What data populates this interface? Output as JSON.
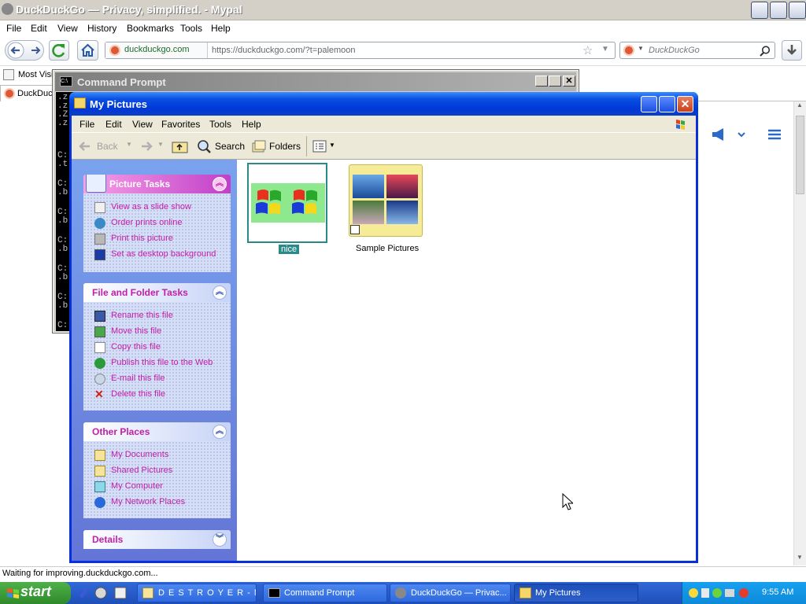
{
  "browser": {
    "window_title": "DuckDuckGo — Privacy, simplified. - Mypal",
    "menu": [
      "File",
      "Edit",
      "View",
      "History",
      "Bookmarks",
      "Tools",
      "Help"
    ],
    "identity": "duckduckgo.com",
    "url": "https://duckduckgo.com/?t=palemoon",
    "search_placeholder": "DuckDuckGo",
    "bookmark_item": "Most Visit",
    "tab_label": "DuckDuckGo",
    "status": "Waiting for improving.duckduckgo.com..."
  },
  "cmd": {
    "title": "Command Prompt",
    "lines": [
      ".z",
      ".z",
      ".Z",
      ".z",
      "C:",
      ".t",
      "C:",
      ".b",
      "C:",
      ".b",
      "C:",
      ".b",
      "C:",
      ".b",
      "C:",
      ".b",
      "C:"
    ]
  },
  "explorer": {
    "title": "My Pictures",
    "menu": [
      "File",
      "Edit",
      "View",
      "Favorites",
      "Tools",
      "Help"
    ],
    "toolbar": {
      "back": "Back",
      "search": "Search",
      "folders": "Folders"
    },
    "panels": {
      "picture_tasks": {
        "title": "Picture Tasks",
        "items": [
          "View as a slide show",
          "Order prints online",
          "Print this picture",
          "Set as desktop background"
        ]
      },
      "file_folder_tasks": {
        "title": "File and Folder Tasks",
        "items": [
          "Rename this file",
          "Move this file",
          "Copy this file",
          "Publish this file to the Web",
          "E-mail this file",
          "Delete this file"
        ]
      },
      "other_places": {
        "title": "Other Places",
        "items": [
          "My Documents",
          "Shared Pictures",
          "My Computer",
          "My Network Places"
        ]
      },
      "details": {
        "title": "Details"
      }
    },
    "files": [
      {
        "name": "nice",
        "selected": true
      },
      {
        "name": "Sample Pictures",
        "selected": false
      }
    ]
  },
  "taskbar": {
    "start": "start",
    "buttons": [
      "D E S T R O Y E R - N...",
      "Command Prompt",
      "DuckDuckGo — Privac...",
      "My Pictures"
    ],
    "active_button": "My Pictures",
    "clock": "9:55 AM"
  },
  "colors": {
    "xp_blue": "#0831d9",
    "task_pink": "#c020a8",
    "taskbar": "#2a5fcc",
    "start_green": "#3c9a37"
  }
}
